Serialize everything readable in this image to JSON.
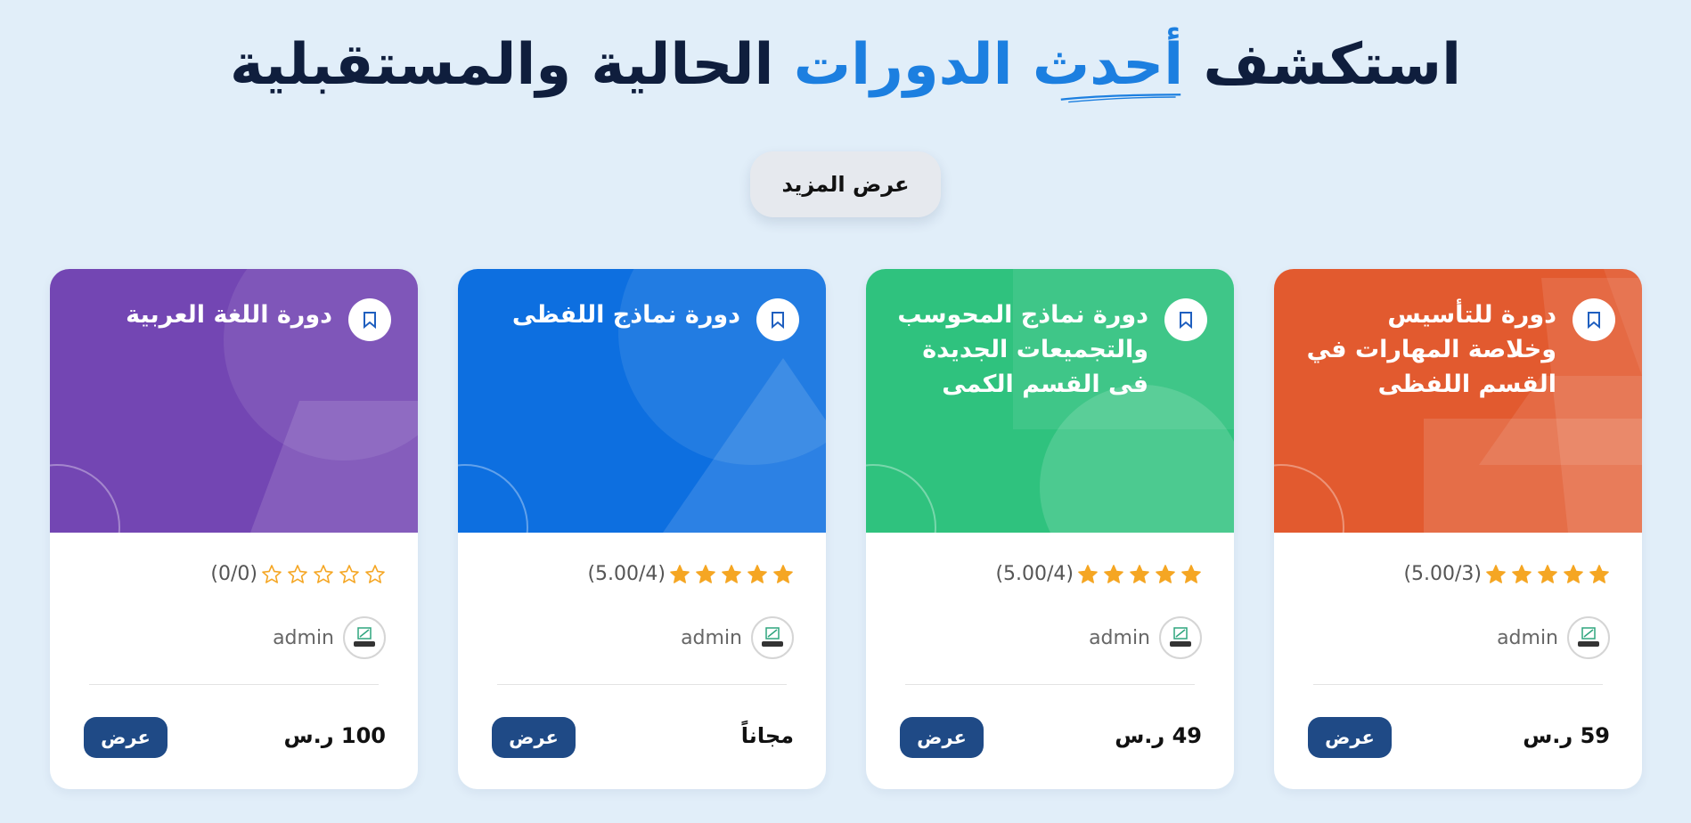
{
  "header": {
    "title_part1": "استكشف",
    "title_accent": "أحدث الدورات",
    "title_part2": "الحالية والمستقبلية",
    "accent_color": "#1c7fe0"
  },
  "more_button": {
    "label": "عرض المزيد"
  },
  "cards": [
    {
      "title": "دورة للتأسيس وخلاصة المهارات في القسم اللفظى",
      "color": "#e25a2f",
      "rating_value": 5,
      "rating_text": "(5.00/3)",
      "author": "admin",
      "price": "59 ر.س",
      "view_label": "عرض"
    },
    {
      "title": "دورة نماذج المحوسب والتجميعات الجديدة فى القسم الكمى",
      "color": "#2fc27e",
      "rating_value": 5,
      "rating_text": "(5.00/4)",
      "author": "admin",
      "price": "49 ر.س",
      "view_label": "عرض"
    },
    {
      "title": "دورة نماذج اللفظى",
      "color": "#0d6fe0",
      "rating_value": 5,
      "rating_text": "(5.00/4)",
      "author": "admin",
      "price": "مجاناً",
      "view_label": "عرض"
    },
    {
      "title": "دورة اللغة العربية",
      "color": "#7346b3",
      "rating_value": 0,
      "rating_text": "(0/0)",
      "author": "admin",
      "price": "100 ر.س",
      "view_label": "عرض"
    }
  ],
  "icons": {
    "bookmark": "bookmark-icon",
    "star": "star-icon",
    "avatar": "avatar-icon"
  },
  "colors": {
    "star": "#f5a623",
    "view_button": "#1f4a86",
    "background": "#e1eef9"
  }
}
